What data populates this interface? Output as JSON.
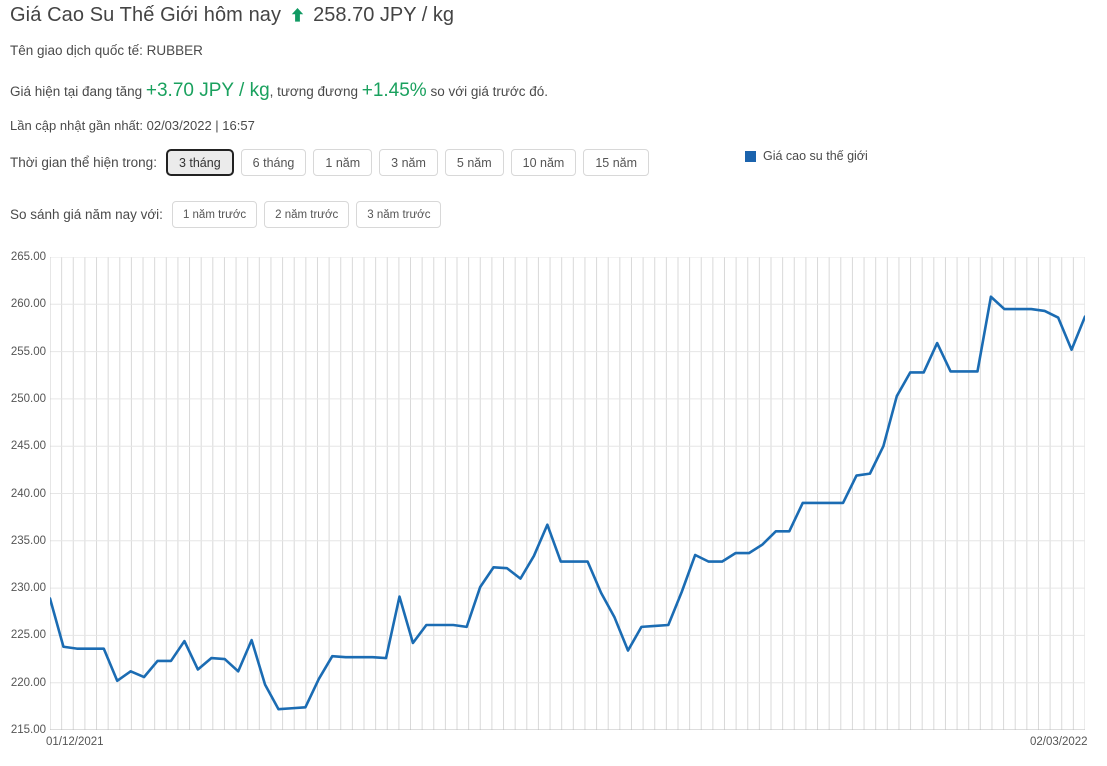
{
  "header": {
    "title": "Giá Cao Su Thế Giới hôm nay",
    "arrow_icon": "arrow-up-icon",
    "price": "258.70 JPY / kg",
    "trend_color": "#119a63"
  },
  "symbol_line": "Tên giao dịch quốc tế: RUBBER",
  "change": {
    "prefix": "Giá hiện tại đang tăng",
    "amount": "+3.70 JPY / kg",
    "middle": ", tương đương",
    "percent": "+1.45%",
    "suffix": "so với giá trước đó.",
    "color": "#1aa15e"
  },
  "updated": "Lần cập nhật gần nhất: 02/03/2022 | 16:57",
  "range_selector": {
    "label": "Thời gian thể hiện trong:",
    "options": [
      "3 tháng",
      "6 tháng",
      "1 năm",
      "3 năm",
      "5 năm",
      "10 năm",
      "15 năm"
    ],
    "selected": "3 tháng"
  },
  "compare_selector": {
    "label": "So sánh giá năm nay với:",
    "options": [
      "1 năm trước",
      "2 năm trước",
      "3 năm trước"
    ],
    "selected": ""
  },
  "legend": {
    "swatch_color": "#1b63ad",
    "label": "Giá cao su thế giới"
  },
  "chart_data": {
    "type": "line",
    "title": "",
    "xlabel": "",
    "ylabel": "",
    "series_name": "Giá cao su thế giới",
    "line_color": "#1b6cb3",
    "grid": true,
    "legend_position": "top-right",
    "ylim": [
      215.0,
      265.0
    ],
    "yticks": [
      "265.00",
      "260.00",
      "255.00",
      "250.00",
      "245.00",
      "240.00",
      "235.00",
      "230.00",
      "225.00",
      "220.00",
      "215.00"
    ],
    "ytick_values": [
      265,
      260,
      255,
      250,
      245,
      240,
      235,
      230,
      225,
      220,
      215
    ],
    "xticks": [
      "01/12/2021",
      "02/03/2022"
    ],
    "x_start": "01/12/2021",
    "x_end": "02/03/2022",
    "unit": "JPY / kg",
    "values": [
      228.9,
      223.8,
      223.6,
      223.6,
      223.6,
      220.2,
      221.2,
      220.6,
      222.3,
      222.3,
      224.4,
      221.4,
      222.6,
      222.5,
      221.2,
      224.5,
      219.8,
      217.2,
      217.3,
      217.4,
      220.4,
      222.8,
      222.7,
      222.7,
      222.7,
      222.6,
      229.1,
      224.2,
      226.1,
      226.1,
      226.1,
      225.9,
      230.1,
      232.2,
      232.1,
      231.0,
      233.4,
      236.7,
      232.8,
      232.8,
      232.8,
      229.5,
      226.9,
      223.4,
      225.9,
      226.0,
      226.1,
      229.6,
      233.5,
      232.8,
      232.8,
      233.7,
      233.7,
      234.6,
      236.0,
      236.0,
      239.0,
      239.0,
      239.0,
      239.0,
      241.9,
      242.1,
      245.0,
      250.3,
      252.8,
      252.8,
      255.9,
      252.9,
      252.9,
      252.9,
      260.8,
      259.5,
      259.5,
      259.5,
      259.3,
      258.6,
      255.2,
      258.7
    ]
  }
}
